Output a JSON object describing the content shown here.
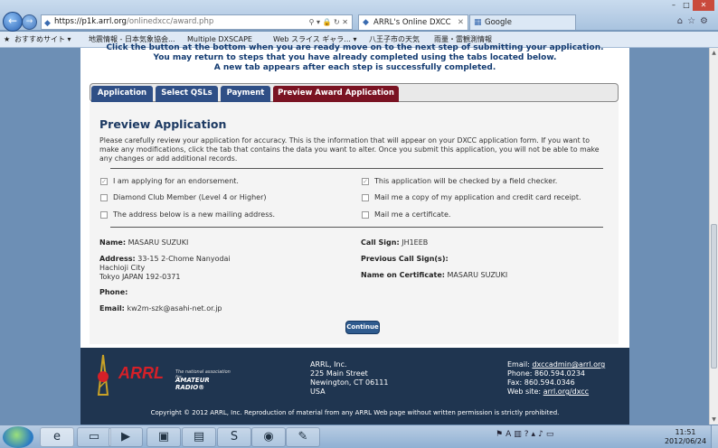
{
  "browser": {
    "url_host": "https://p1k.arrl.org",
    "url_path": "/onlinedxcc/award.php",
    "tabs": [
      {
        "label": "ARRL's Online DXCC"
      },
      {
        "label": "Google"
      }
    ],
    "favorites": [
      {
        "label": "おすすめサイト ▾"
      },
      {
        "label": "地震情報 - 日本気象協会..."
      },
      {
        "label": "Multiple DXSCAPE"
      },
      {
        "label": "Web スライス ギャラ... ▾"
      },
      {
        "label": "八王子市の天気"
      },
      {
        "label": "雨量・雷観測情報"
      }
    ]
  },
  "instructions": [
    "Click the button at the bottom when you are ready move on to the next step of submitting your application.",
    "You may return to steps that you have already completed using the tabs located below.",
    "A new tab appears after each step is successfully completed."
  ],
  "steps": [
    {
      "label": "Application"
    },
    {
      "label": "Select QSLs"
    },
    {
      "label": "Payment"
    },
    {
      "label": "Preview Award Application"
    }
  ],
  "preview": {
    "title": "Preview Application",
    "description": "Please carefully review your application for accuracy. This is the information that will appear on your DXCC application form. If you want to make any modifications, click the tab that contains the data you want to alter. Once you submit this application, you will not be able to make any changes or add additional records.",
    "options": [
      {
        "label": "I am applying for an endorsement.",
        "mark": "✓"
      },
      {
        "label": "This application will be checked by a field checker.",
        "mark": "✓"
      },
      {
        "label": "Diamond Club Member (Level 4 or Higher)",
        "mark": ""
      },
      {
        "label": "Mail me a copy of my application and credit card receipt.",
        "mark": ""
      },
      {
        "label": "The address below is a new mailing address.",
        "mark": ""
      },
      {
        "label": "Mail me a certificate.",
        "mark": ""
      }
    ],
    "name_label": "Name:",
    "name_value": "MASARU SUZUKI",
    "address_label": "Address:",
    "address_line1": "33-15 2-Chome Nanyodai",
    "address_line2": "Hachioji City",
    "address_line3": "Tokyo JAPAN 192-0371",
    "phone_label": "Phone:",
    "email_label": "Email:",
    "email_value": "kw2m-szk@asahi-net.or.jp",
    "callsign_label": "Call Sign:",
    "callsign_value": "JH1EEB",
    "prev_callsign_label": "Previous Call Sign(s):",
    "cert_name_label": "Name on Certificate:",
    "cert_name_value": "MASARU SUZUKI",
    "continue_label": "Continue"
  },
  "footer": {
    "logo_text": "ARRL",
    "logo_sub1": "The national association for",
    "logo_sub2": "AMATEUR RADIO®",
    "org": "ARRL, Inc.",
    "street": "225 Main Street",
    "city": "Newington, CT 06111",
    "country": "USA",
    "email_label": "Email:",
    "email": "dxccadmin@arrl.org",
    "phone": "Phone: 860.594.0234",
    "fax": "Fax: 860.594.0346",
    "web_label": "Web site:",
    "web": "arrl.org/dxcc",
    "copyright": "Copyright © 2012 ARRL, Inc. Reproduction of material from any ARRL Web page without written permission is strictly prohibited."
  },
  "clock": {
    "time": "11:51",
    "date": "2012/06/24"
  }
}
